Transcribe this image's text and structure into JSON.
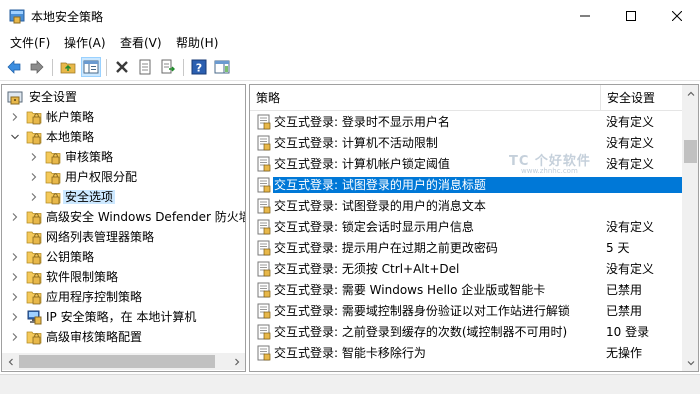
{
  "window": {
    "title": "本地安全策略",
    "icon": "security-policy-icon"
  },
  "menu": [
    "文件(F)",
    "操作(A)",
    "查看(V)",
    "帮助(H)"
  ],
  "toolbar": {
    "buttons": [
      "back-arrow-icon",
      "forward-arrow-icon",
      "up-folder-icon",
      "show-hide-tree-icon",
      "delete-icon",
      "properties-icon",
      "export-list-icon",
      "help-icon",
      "show-hide-action-pane-icon"
    ]
  },
  "tree": {
    "root": "安全设置",
    "items": [
      {
        "label": "帐户策略",
        "level": 1,
        "expanded": false
      },
      {
        "label": "本地策略",
        "level": 1,
        "expanded": true
      },
      {
        "label": "审核策略",
        "level": 2,
        "expanded": false
      },
      {
        "label": "用户权限分配",
        "level": 2,
        "expanded": false
      },
      {
        "label": "安全选项",
        "level": 2,
        "expanded": false,
        "selected": true
      },
      {
        "label": "高级安全 Windows Defender 防火墙",
        "level": 1,
        "expanded": false
      },
      {
        "label": "网络列表管理器策略",
        "level": 1,
        "expanded": null
      },
      {
        "label": "公钥策略",
        "level": 1,
        "expanded": false
      },
      {
        "label": "软件限制策略",
        "level": 1,
        "expanded": false
      },
      {
        "label": "应用程序控制策略",
        "level": 1,
        "expanded": false
      },
      {
        "label": "IP 安全策略，在 本地计算机",
        "level": 1,
        "expanded": false
      },
      {
        "label": "高级审核策略配置",
        "level": 1,
        "expanded": false
      }
    ]
  },
  "list": {
    "columns": [
      "策略",
      "安全设置"
    ],
    "rows": [
      {
        "policy": "交互式登录: 登录时不显示用户名",
        "setting": "没有定义"
      },
      {
        "policy": "交互式登录: 计算机不活动限制",
        "setting": "没有定义"
      },
      {
        "policy": "交互式登录: 计算机帐户锁定阈值",
        "setting": "没有定义"
      },
      {
        "policy": "交互式登录: 试图登录的用户的消息标题",
        "setting": "",
        "selected": true
      },
      {
        "policy": "交互式登录: 试图登录的用户的消息文本",
        "setting": ""
      },
      {
        "policy": "交互式登录: 锁定会话时显示用户信息",
        "setting": "没有定义"
      },
      {
        "policy": "交互式登录: 提示用户在过期之前更改密码",
        "setting": "5 天"
      },
      {
        "policy": "交互式登录: 无须按 Ctrl+Alt+Del",
        "setting": "没有定义"
      },
      {
        "policy": "交互式登录: 需要 Windows Hello 企业版或智能卡",
        "setting": "已禁用"
      },
      {
        "policy": "交互式登录: 需要域控制器身份验证以对工作站进行解锁",
        "setting": "已禁用"
      },
      {
        "policy": "交互式登录: 之前登录到缓存的次数(域控制器不可用时)",
        "setting": "10 登录"
      },
      {
        "policy": "交互式登录: 智能卡移除行为",
        "setting": "无操作"
      }
    ]
  },
  "watermark": {
    "line1": "TC 个好软件",
    "line2": "www.zhnhc.com"
  },
  "colors": {
    "selection": "#0078d7",
    "tree_selection": "#cce8ff",
    "folder": "#e8b84a"
  }
}
